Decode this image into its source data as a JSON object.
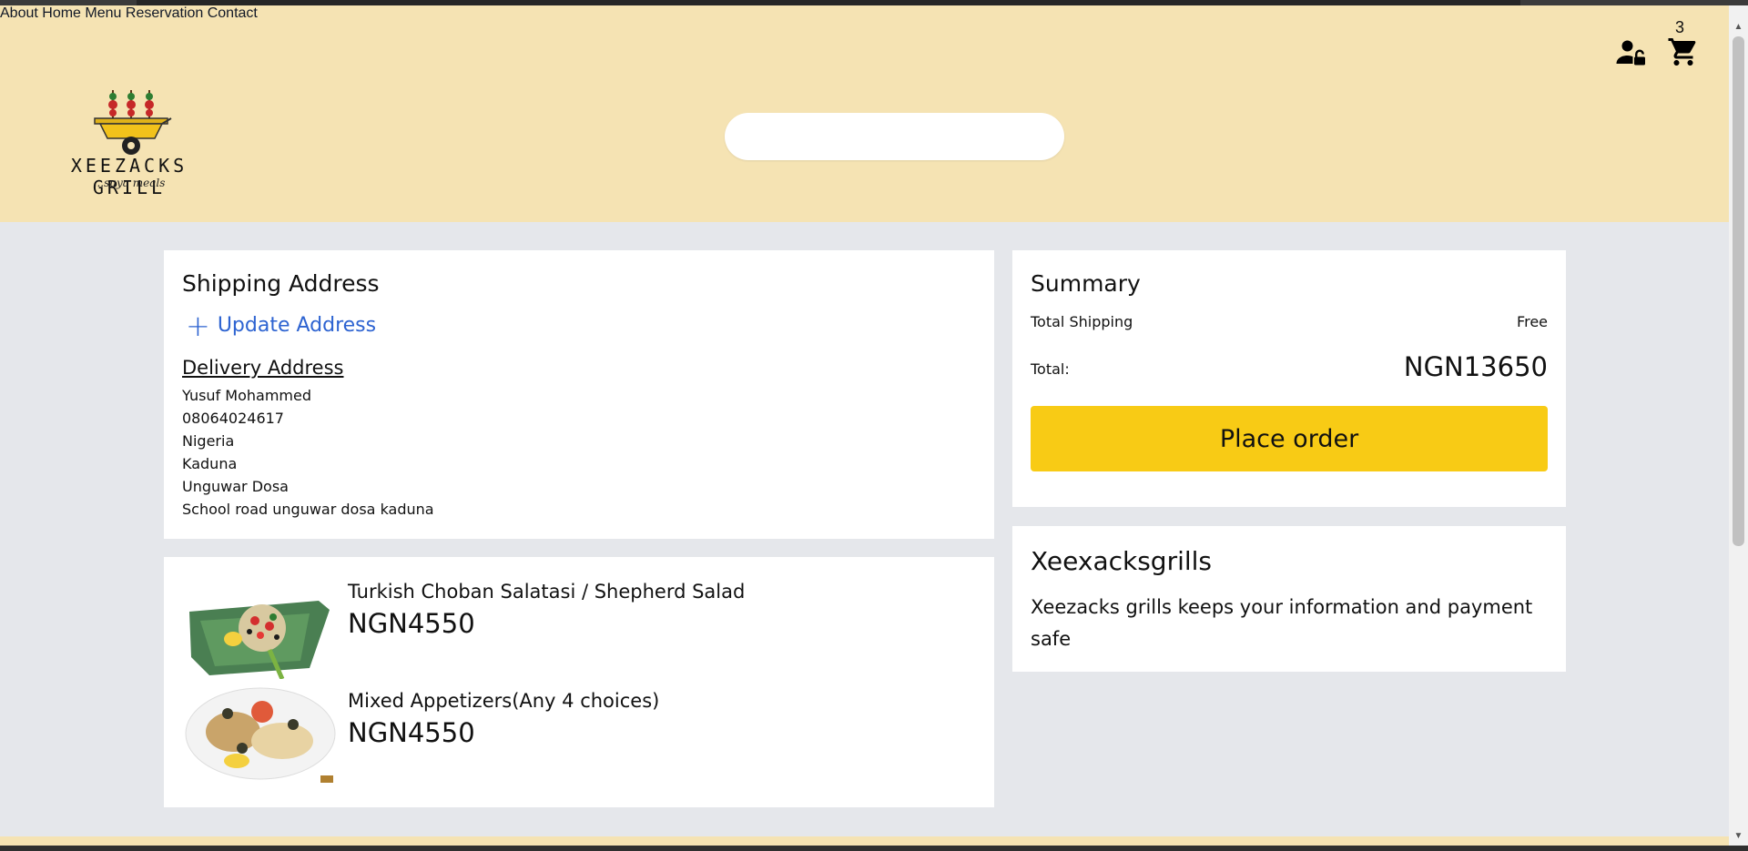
{
  "header": {
    "logo_text": "XEEZACKS GRILL",
    "logo_tagline": "...suya meals",
    "search": {
      "placeholder": "",
      "value": ""
    },
    "nav": [
      {
        "label": "About"
      },
      {
        "label": "Home"
      },
      {
        "label": "Menu"
      },
      {
        "label": "Reservation"
      },
      {
        "label": "Contact"
      }
    ],
    "cart_count": "3"
  },
  "shipping": {
    "title": "Shipping Address",
    "update_label": "Update Address",
    "delivery_title": "Delivery Address",
    "lines": [
      "Yusuf Mohammed",
      "08064024617",
      "Nigeria",
      "Kaduna",
      "Unguwar Dosa",
      "School road unguwar dosa kaduna"
    ]
  },
  "items": [
    {
      "name": "Turkish Choban Salatasi / Shepherd Salad",
      "price": "NGN4550",
      "image": "shepherd-salad"
    },
    {
      "name": "Mixed Appetizers(Any 4 choices)",
      "price": "NGN4550",
      "image": "mixed-appetizers"
    }
  ],
  "summary": {
    "title": "Summary",
    "shipping_label": "Total Shipping",
    "shipping_value": "Free",
    "total_label": "Total:",
    "total_value": "NGN13650",
    "place_order": "Place order"
  },
  "info": {
    "title": "Xeexacksgrills",
    "text": "Xeezacks grills keeps your information and payment safe"
  },
  "colors": {
    "header_bg": "#f5e3b3",
    "page_bg": "#e5e7eb",
    "accent_button": "#f8cb15",
    "link_blue": "#2d63d1"
  },
  "icons": [
    "user-lock-icon",
    "cart-icon",
    "plus-icon"
  ]
}
